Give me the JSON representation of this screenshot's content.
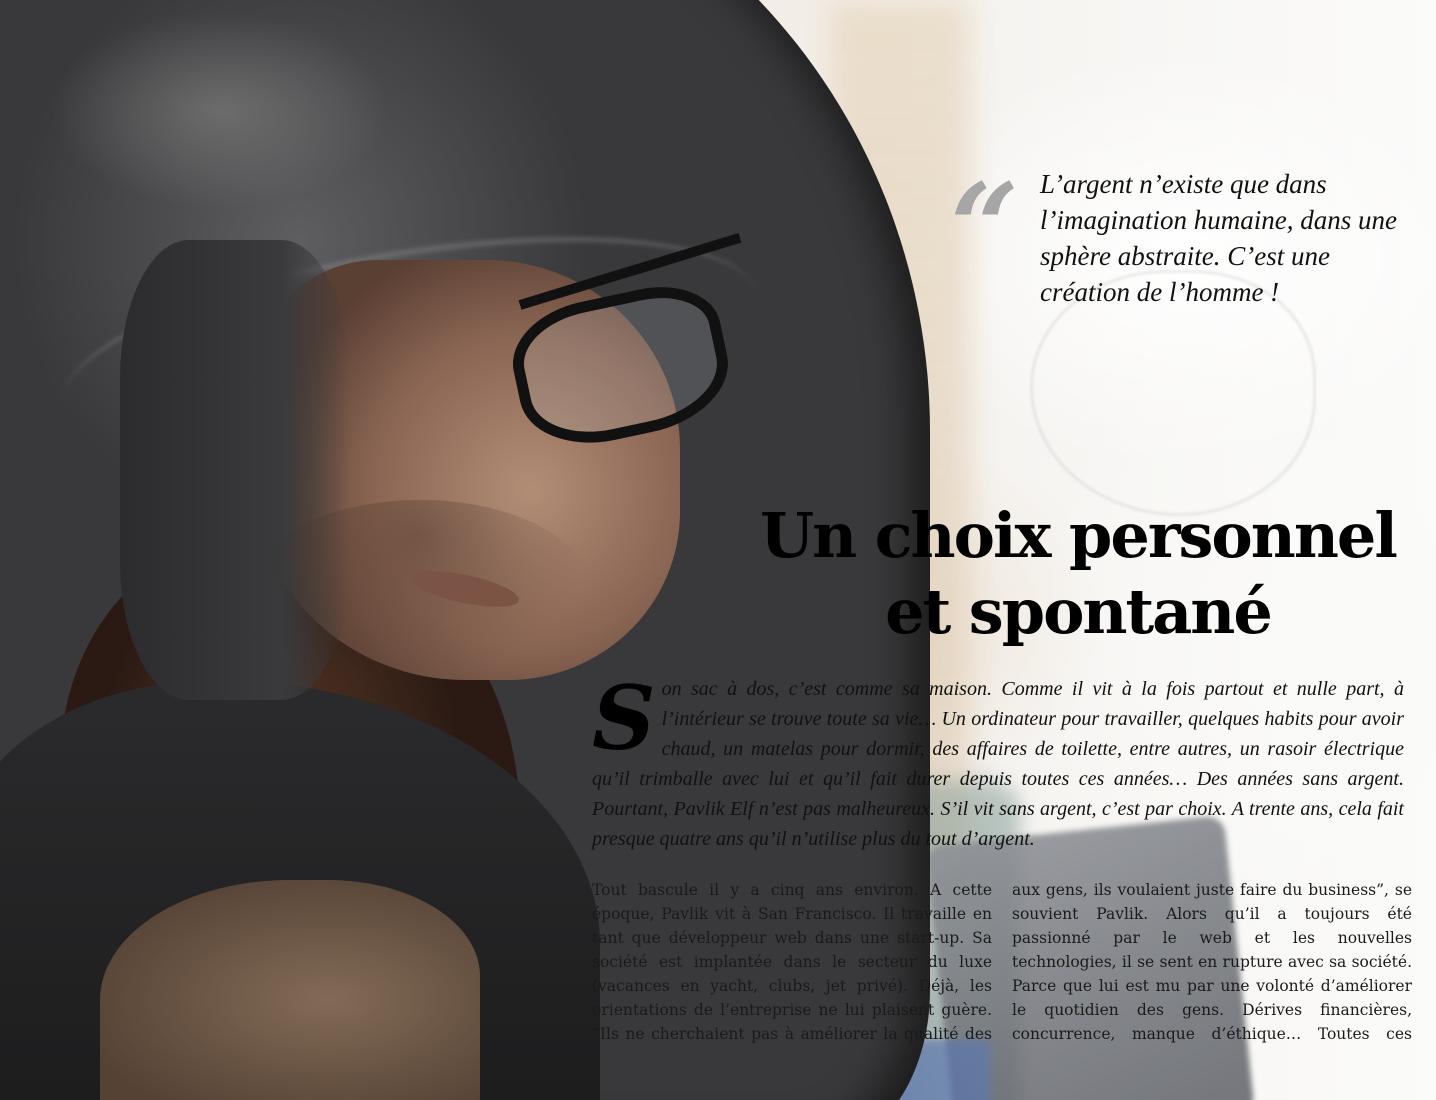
{
  "quote": {
    "mark": "“",
    "text": "L’argent n’existe que dans l’imagination humaine, dans une sphère abstraite. C’est une création de l’homme !"
  },
  "headline": {
    "line1": "Un choix personnel",
    "line2": "et spontané"
  },
  "lede": {
    "drop_cap": "S",
    "text": "on sac à dos, c’est comme sa maison. Comme il vit à la fois partout et nulle part, à l’intérieur se trouve toute sa vie… Un ordinateur pour travailler, quelques habits pour avoir chaud, un matelas pour dormir, des affaires de toilette, entre autres, un rasoir électrique qu’il trimballe avec lui et qu’il fait durer depuis toutes ces années… Des années sans argent. Pourtant, Pavlik Elf n’est pas malheureux. S’il vit sans argent, c’est par choix. A trente ans, cela fait presque quatre ans qu’il n’utilise plus du tout d’argent."
  },
  "body": {
    "col1": "Tout bascule il y a cinq ans environ. A cette époque, Pavlik vit à San Francisco. Il travaille en tant que développeur web dans une start-up. Sa société est implantée dans le secteur du luxe (vacances en yacht, clubs, jet privé). Déjà, les orientations de l’entreprise ne lui plaisent guère. “Ils ne cherchaient pas à améliorer la qualité des services proposés",
    "col2": "aux gens, ils voulaient juste faire du business”, se souvient Pavlik. Alors qu’il a toujours été passionné par le web et les nouvelles technologies, il se sent en rupture avec sa société. Parce que lui est mu par une volonté d’améliorer le quotidien des gens. Dérives financières, concurrence, manque d’éthique… Toutes ces choses auxquelles il assiste chaque jour,"
  }
}
